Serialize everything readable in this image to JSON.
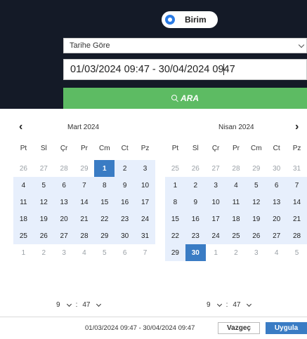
{
  "birim": {
    "label": "Birim",
    "checked": true
  },
  "filter_select": {
    "value": "Tarihe Göre"
  },
  "range_input": {
    "value_before_cursor": "01/03/2024 09:47  - 30/04/2024 09",
    "value_after_cursor": "47"
  },
  "search_button": {
    "label": "ARA"
  },
  "nav": {
    "prev": "‹",
    "next": "›"
  },
  "weekdays": [
    "Pt",
    "Sl",
    "Çr",
    "Pr",
    "Cm",
    "Ct",
    "Pz"
  ],
  "left_calendar": {
    "title": "Mart 2024",
    "weeks": [
      [
        "26",
        "27",
        "28",
        "29",
        "1",
        "2",
        "3"
      ],
      [
        "4",
        "5",
        "6",
        "7",
        "8",
        "9",
        "10"
      ],
      [
        "11",
        "12",
        "13",
        "14",
        "15",
        "16",
        "17"
      ],
      [
        "18",
        "19",
        "20",
        "21",
        "22",
        "23",
        "24"
      ],
      [
        "25",
        "26",
        "27",
        "28",
        "29",
        "30",
        "31"
      ],
      [
        "1",
        "2",
        "3",
        "4",
        "5",
        "6",
        "7"
      ]
    ],
    "off_rows": [
      0,
      5
    ],
    "off_cols_row0": [
      0,
      1,
      2,
      3
    ],
    "in_rows": [
      1,
      2,
      3,
      4
    ],
    "in_row0_cols": [
      4,
      5,
      6
    ],
    "selected": [
      0,
      4
    ],
    "time": {
      "hour": "9",
      "minute": "47"
    }
  },
  "right_calendar": {
    "title": "Nisan 2024",
    "weeks": [
      [
        "25",
        "26",
        "27",
        "28",
        "29",
        "30",
        "31"
      ],
      [
        "1",
        "2",
        "3",
        "4",
        "5",
        "6",
        "7"
      ],
      [
        "8",
        "9",
        "10",
        "11",
        "12",
        "13",
        "14"
      ],
      [
        "15",
        "16",
        "17",
        "18",
        "19",
        "20",
        "21"
      ],
      [
        "22",
        "23",
        "24",
        "25",
        "26",
        "27",
        "28"
      ],
      [
        "29",
        "30",
        "1",
        "2",
        "3",
        "4",
        "5"
      ]
    ],
    "selected": [
      5,
      1
    ],
    "time": {
      "hour": "9",
      "minute": "47"
    }
  },
  "footer": {
    "range_text": "01/03/2024 09:47 - 30/04/2024 09:47",
    "cancel_label": "Vazgeç",
    "apply_label": "Uygula"
  },
  "colors": {
    "accent": "#3a7cc4",
    "range_bg": "#e7effc",
    "search_green": "#5dbb63",
    "header_bg": "#141a27"
  }
}
